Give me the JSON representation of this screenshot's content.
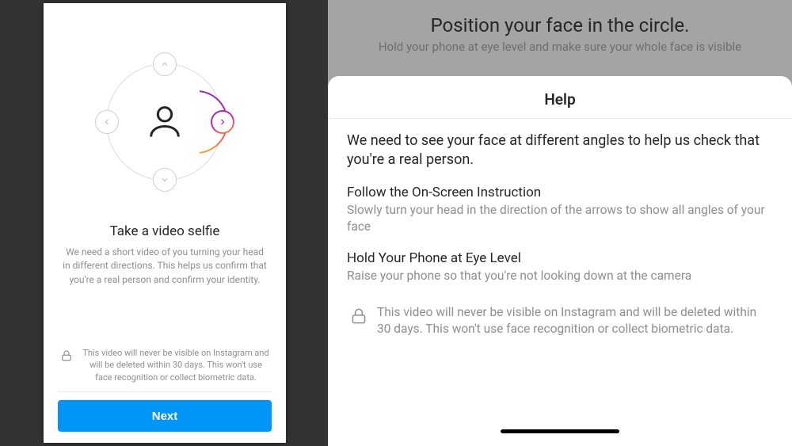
{
  "left": {
    "title": "Take a video selfie",
    "body": "We need a short video of you turning your head in different directions. This helps us confirm that you're a real person and confirm your identity.",
    "privacy": "This video will never be visible on Instagram and will be deleted within 30 days. This won't use face recognition or collect biometric data.",
    "next_label": "Next"
  },
  "right": {
    "bg_title": "Position your face in the circle.",
    "bg_sub": "Hold your phone at eye level and make sure your whole face is visible",
    "sheet_title": "Help",
    "lead": "We need to see your face at different angles to help us check that you're a real person.",
    "section1_h": "Follow the On-Screen Instruction",
    "section1_p": "Slowly turn your head in the direction of the arrows to show all angles of your face",
    "section2_h": "Hold Your Phone at Eye Level",
    "section2_p": "Raise your phone so that you're not looking down at the camera",
    "privacy": "This video will never be visible on Instagram and will be deleted within 30 days. This won't use face recognition or collect biometric data."
  }
}
